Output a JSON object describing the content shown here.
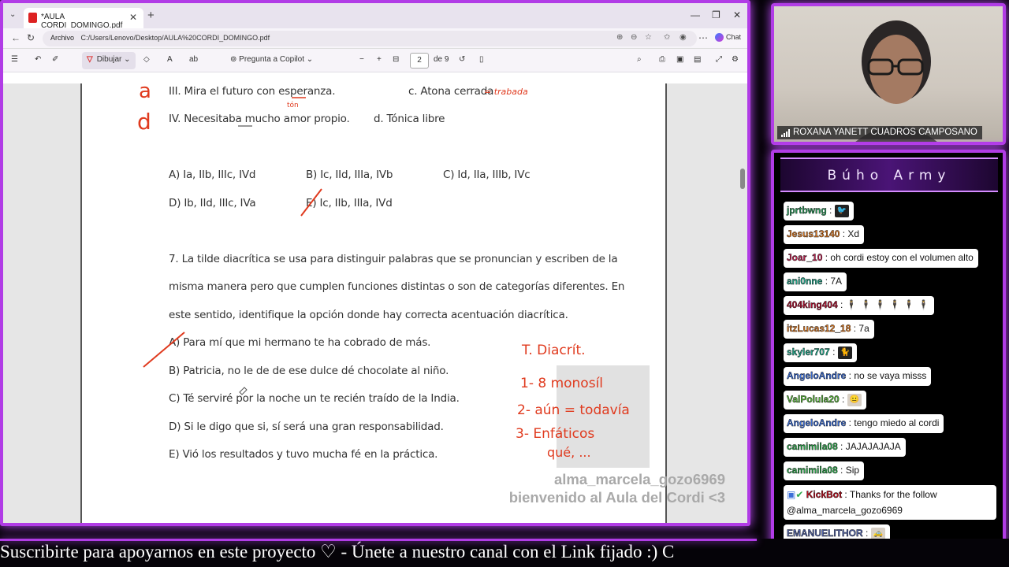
{
  "browser": {
    "tab_title": "*AULA CORDI_DOMINGO.pdf",
    "tab_close": "✕",
    "new_tab": "+",
    "menu_chevron": "⌄",
    "win_min": "—",
    "win_max": "❐",
    "win_close": "✕",
    "address_label": "Archivo",
    "url": "C:/Users/Lenovo/Desktop/AULA%20CORDI_DOMINGO.pdf",
    "chat_label": "Chat"
  },
  "pdf_toolbar": {
    "draw_label": "Dibujar",
    "copilot_label": "Pregunta a Copilot",
    "page_current": "2",
    "page_total": "de 9",
    "zoom_out": "−",
    "zoom_in": "+"
  },
  "document": {
    "line_iii": "III. Mira el futuro con esperanza.",
    "opt_c": "c. Atona cerrada",
    "line_iv": "IV. Necesitaba mucho amor propio.",
    "opt_d": "d. Tónica libre",
    "ans_a": "A) Ia, IIb, IIIc, IVd",
    "ans_b": "B) Ic, IId, IIIa, IVb",
    "ans_c": "C) Id, IIa, IIIb, IVc",
    "ans_d": "D) Ib, IId, IIIc, IVa",
    "ans_e": "E) Ic, IIb, IIIa, IVd",
    "q7_line1": "7. La tilde diacrítica se usa para distinguir palabras que se pronuncian y escriben de la",
    "q7_line2": "misma manera pero que cumplen funciones distintas o son de categorías diferentes. En",
    "q7_line3": "este sentido, identifique la opción donde hay correcta acentuación diacrítica.",
    "q7_a": "A) Para mí que mi hermano te ha cobrado de más.",
    "q7_b": "B) Patricia, no le de de ese dulce dé chocolate al niño.",
    "q7_c": "C) Té serviré por la noche un te recién traído de la India.",
    "q7_d": "D) Si le digo que si, sí será una gran responsabilidad.",
    "q7_e": "E) Vió los resultados y tuvo mucha fé en la práctica."
  },
  "annotations": {
    "letter_a": "a",
    "letter_d": "d",
    "under_esperanza": "tón",
    "trabada": "= trabada",
    "notes_title": "T. Diacrít.",
    "note1": "1- 8 monosíl",
    "note2": "2- aún = todavía",
    "note3": "3- Enfáticos",
    "note4": "qué, ...",
    "ink_color": "#e03a1e"
  },
  "overlay": {
    "follower_name": "alma_marcela_gozo6969",
    "welcome_text": "bienvenido al Aula del Cordi <3"
  },
  "webcam": {
    "name": "ROXANA YANETT CUADROS CAMPOSANO"
  },
  "chat": {
    "title": "Búho Army",
    "messages": [
      {
        "user": "jprtbwng",
        "user_color": "#2a9d5c",
        "text": "",
        "emote": "🐦"
      },
      {
        "user": "Jesus13140",
        "user_color": "#e07b24",
        "text": "Xd",
        "emote": ""
      },
      {
        "user": "Joar_10",
        "user_color": "#c02050",
        "text": "oh cordi estoy con el volumen alto",
        "emote": ""
      },
      {
        "user": "ani0nne",
        "user_color": "#1fa88a",
        "text": "7A",
        "emote": ""
      },
      {
        "user": "404king404",
        "user_color": "#b01030",
        "text": "",
        "emote": "🕴 🕴 🕴 🕴 🕴 🕴"
      },
      {
        "user": "itzLucas12_18",
        "user_color": "#e07b24",
        "text": "7a",
        "emote": ""
      },
      {
        "user": "skyler707",
        "user_color": "#1fa88a",
        "text": "",
        "emote": "🐈"
      },
      {
        "user": "AngeloAndre",
        "user_color": "#3c6fd8",
        "text": "no se vaya misss",
        "emote": ""
      },
      {
        "user": "ValPolula20",
        "user_color": "#58b83a",
        "text": "",
        "emote": "😐"
      },
      {
        "user": "AngeloAndre",
        "user_color": "#3c6fd8",
        "text": "tengo miedo al cordi",
        "emote": ""
      },
      {
        "user": "camimila08",
        "user_color": "#2aa84a",
        "text": "JAJAJAJAJA",
        "emote": ""
      },
      {
        "user": "camimila08",
        "user_color": "#2aa84a",
        "text": "Sip",
        "emote": ""
      },
      {
        "user": "KickBot",
        "user_color": "#c01020",
        "text": "Thanks for the follow",
        "text2": "@alma_marcela_gozo6969",
        "emote": ""
      },
      {
        "user": "EMANUELITHOR",
        "user_color": "#5566aa",
        "text": "",
        "emote": "🚕"
      }
    ]
  },
  "ticker": {
    "text": "Suscribirte para apoyarnos en este proyecto ♡  -  Únete a nuestro canal con el Link fijado :)  C"
  }
}
